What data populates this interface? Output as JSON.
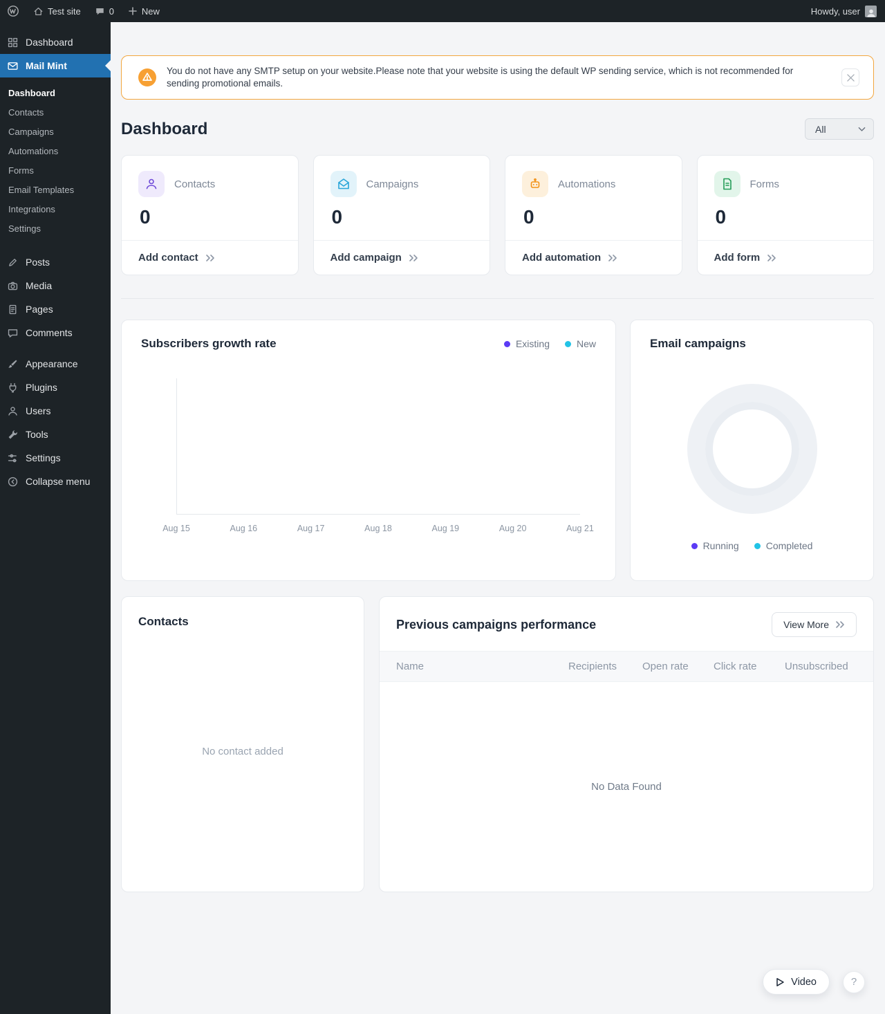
{
  "admin_bar": {
    "site_name": "Test site",
    "comment_count": "0",
    "new_label": "New",
    "greeting": "Howdy, user"
  },
  "sidebar": {
    "dashboard": "Dashboard",
    "mailmint": "Mail Mint",
    "submenu": [
      "Dashboard",
      "Contacts",
      "Campaigns",
      "Automations",
      "Forms",
      "Email Templates",
      "Integrations",
      "Settings"
    ],
    "content_items": [
      "Posts",
      "Media",
      "Pages",
      "Comments"
    ],
    "site_items": [
      "Appearance",
      "Plugins",
      "Users",
      "Tools",
      "Settings"
    ],
    "collapse": "Collapse menu"
  },
  "banner": {
    "message": "You do not have any SMTP setup on your website.Please note that your website is using the default WP sending service, which is not recommended for sending promotional emails."
  },
  "page": {
    "title": "Dashboard",
    "filter_value": "All"
  },
  "stats": [
    {
      "label": "Contacts",
      "value": "0",
      "action": "Add contact",
      "accent": "#6f4bd8",
      "tint": "#efeafc"
    },
    {
      "label": "Campaigns",
      "value": "0",
      "action": "Add campaign",
      "accent": "#2aa6d9",
      "tint": "#e2f3fa"
    },
    {
      "label": "Automations",
      "value": "0",
      "action": "Add automation",
      "accent": "#f29218",
      "tint": "#fdf0dc"
    },
    {
      "label": "Forms",
      "value": "0",
      "action": "Add form",
      "accent": "#259d58",
      "tint": "#e2f5ea"
    }
  ],
  "chart_data": [
    {
      "type": "line",
      "title": "Subscribers growth rate",
      "x": [
        "Aug 15",
        "Aug 16",
        "Aug 17",
        "Aug 18",
        "Aug 19",
        "Aug 20",
        "Aug 21"
      ],
      "series": [
        {
          "name": "Existing",
          "color": "#5b3bf5",
          "values": []
        },
        {
          "name": "New",
          "color": "#22c3e6",
          "values": []
        }
      ],
      "legend_position": "top-right",
      "grid": false,
      "note": "empty chart - no data plotted"
    },
    {
      "type": "pie",
      "title": "Email campaigns",
      "series": [
        {
          "name": "Running",
          "color": "#5b3bf5",
          "value": 0
        },
        {
          "name": "Completed",
          "color": "#22c3e6",
          "value": 0
        }
      ],
      "legend_position": "bottom-center",
      "note": "empty donut - no data plotted"
    }
  ],
  "growth_chart": {
    "title": "Subscribers growth rate",
    "legend": [
      {
        "label": "Existing",
        "color": "#5b3bf5"
      },
      {
        "label": "New",
        "color": "#22c3e6"
      }
    ],
    "x_labels": [
      "Aug 15",
      "Aug 16",
      "Aug 17",
      "Aug 18",
      "Aug 19",
      "Aug 20",
      "Aug 21"
    ]
  },
  "email_campaigns": {
    "title": "Email campaigns",
    "legend": [
      {
        "label": "Running",
        "color": "#5b3bf5"
      },
      {
        "label": "Completed",
        "color": "#22c3e6"
      }
    ]
  },
  "contacts_card": {
    "title": "Contacts",
    "empty_text": "No contact added"
  },
  "campaigns_table": {
    "title": "Previous campaigns performance",
    "view_more": "View More",
    "columns": [
      "Name",
      "Recipients",
      "Open rate",
      "Click rate",
      "Unsubscribed"
    ],
    "empty_text": "No Data Found"
  },
  "footer": {
    "video_label": "Video",
    "help_label": "?"
  },
  "colors": {
    "admin_dark": "#1d2327",
    "active_menu": "#2271b1",
    "warning_border": "#f2a63e",
    "page_bg": "#f4f5f7"
  }
}
